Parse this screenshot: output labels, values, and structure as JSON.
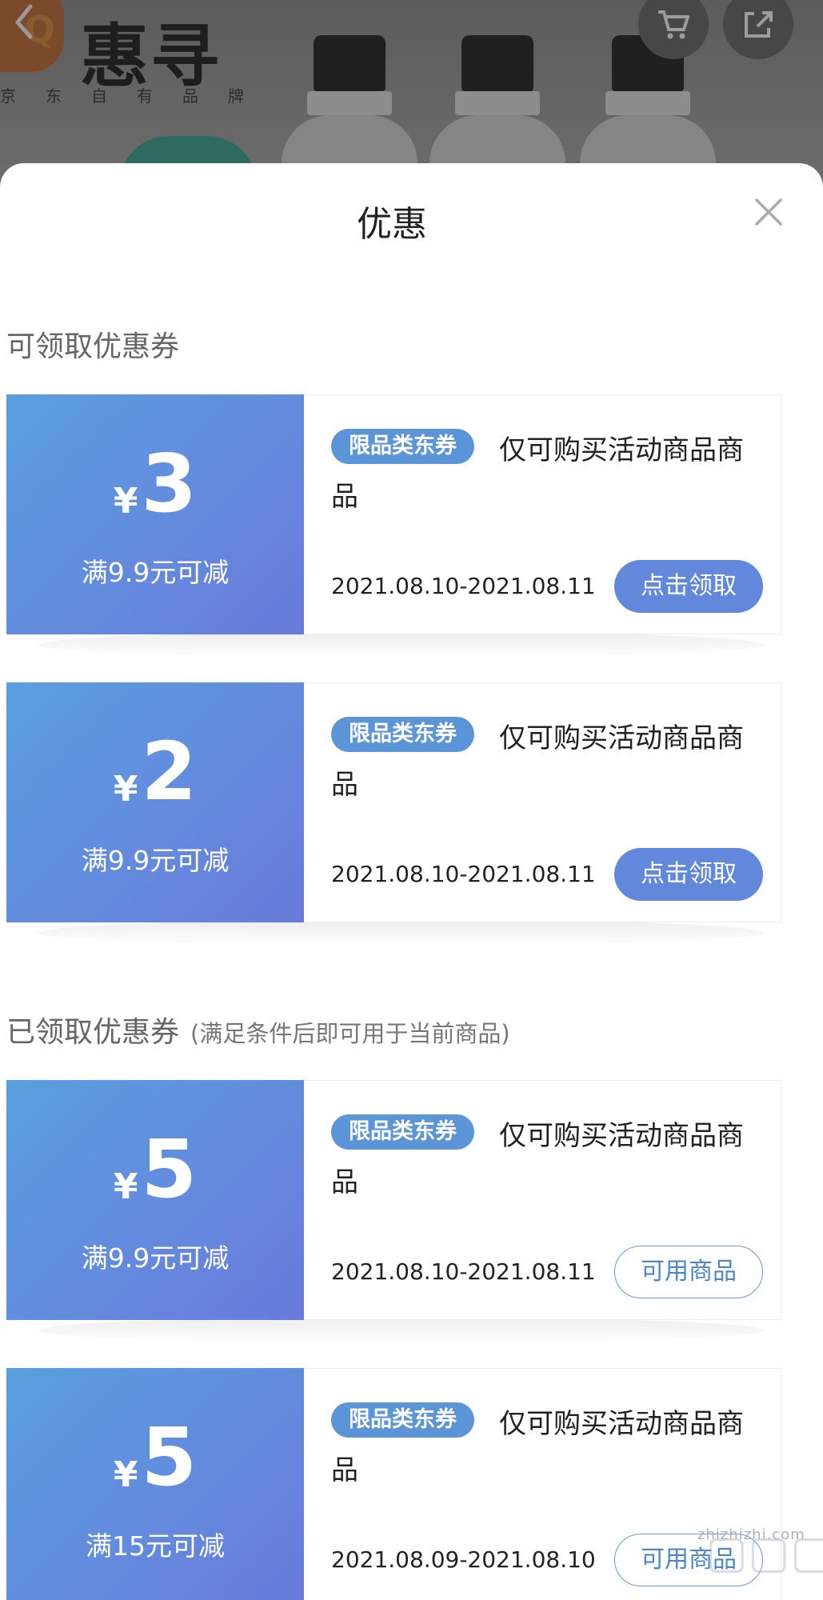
{
  "banner": {
    "brand_name": "惠寻",
    "brand_sub": "京东自有品牌",
    "brand_mark": "Q"
  },
  "sheet": {
    "title": "优惠"
  },
  "sections": {
    "available_heading": "可领取优惠券",
    "claimed_heading": "已领取优惠券",
    "claimed_note": "(满足条件后即可用于当前商品)"
  },
  "coupons": [
    {
      "yen": "¥",
      "amount": "3",
      "threshold": "满9.9元可减",
      "tag": "限品类东券",
      "desc": "仅可购买活动商品商品",
      "dates": "2021.08.10-2021.08.11",
      "action": "点击领取"
    },
    {
      "yen": "¥",
      "amount": "2",
      "threshold": "满9.9元可减",
      "tag": "限品类东券",
      "desc": "仅可购买活动商品商品",
      "dates": "2021.08.10-2021.08.11",
      "action": "点击领取"
    },
    {
      "yen": "¥",
      "amount": "5",
      "threshold": "满9.9元可减",
      "tag": "限品类东券",
      "desc": "仅可购买活动商品商品",
      "dates": "2021.08.10-2021.08.11",
      "action": "可用商品"
    },
    {
      "yen": "¥",
      "amount": "5",
      "threshold": "满15元可减",
      "tag": "限品类东券",
      "desc": "仅可购买活动商品商品",
      "dates": "2021.08.09-2021.08.10",
      "action": "可用商品"
    }
  ],
  "watermark": {
    "text": "zhizhizhi.com"
  },
  "colors": {
    "coupon_gradient_start": "#5a9fdf",
    "coupon_gradient_end": "#6a7adc",
    "tag_blue": "#5b95d8",
    "claim_button": "#6188db"
  },
  "icons": [
    "back-icon",
    "cart-icon",
    "share-icon",
    "close-icon"
  ]
}
